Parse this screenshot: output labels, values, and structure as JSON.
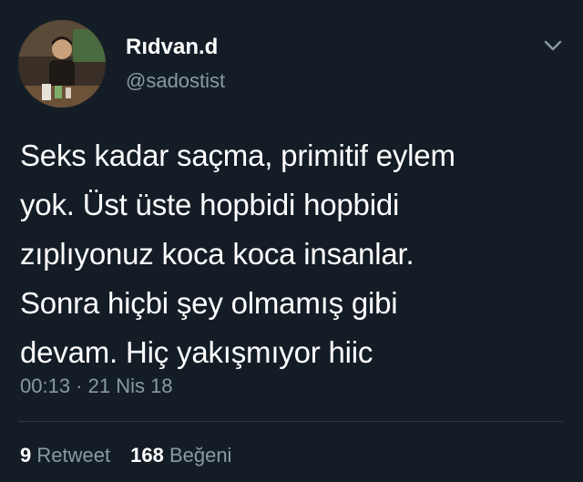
{
  "tweet": {
    "display_name": "Rıdvan.d",
    "handle": "@sadostist",
    "avatar_icon": "user-avatar-photo",
    "menu_icon": "chevron-down-icon",
    "text": "Seks kadar saçma, primitif eylem\nyok. Üst üste hopbidi hopbidi\nzıplıyonuz koca koca insanlar.\nSonra hiçbi şey olmamış gibi\ndevam. Hiç yakışmıyor hiic",
    "timestamp": "00:13 · 21 Nis 18",
    "retweet_count": "9",
    "retweet_label": "Retweet",
    "like_count": "168",
    "like_label": "Beğeni"
  },
  "colors": {
    "background": "#141d26",
    "primary_text": "#ffffff",
    "secondary_text": "#8899a6",
    "divider": "#2b3a48"
  }
}
